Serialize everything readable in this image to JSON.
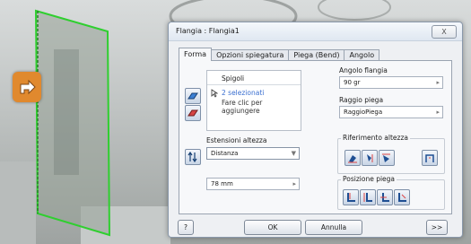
{
  "dialog": {
    "title": "Flangia : Flangia1",
    "close_label": "X",
    "tabs": [
      "Forma",
      "Opzioni spiegatura",
      "Piega (Bend)",
      "Angolo"
    ],
    "edges": {
      "header": "Spigoli",
      "selected": "2 selezionati",
      "hint": "Fare clic per aggiungere"
    },
    "flange_angle": {
      "label": "Angolo flangia",
      "value": "90 gr"
    },
    "bend_radius": {
      "label": "Raggio piega",
      "value": "RaggioPiega"
    },
    "height_extents": {
      "label": "Estensioni altezza",
      "value": "Distanza"
    },
    "height_value": "78 mm",
    "height_datum": {
      "label": "Riferimento altezza"
    },
    "bend_position": {
      "label": "Posizione piega"
    },
    "buttons": {
      "ok": "OK",
      "cancel": "Annulla",
      "more": ">>",
      "help": "?"
    }
  },
  "colors": {
    "flange_edge": "#2fcf2f",
    "accent_orange": "#e0892e",
    "selected_text": "#3a6fd0"
  }
}
